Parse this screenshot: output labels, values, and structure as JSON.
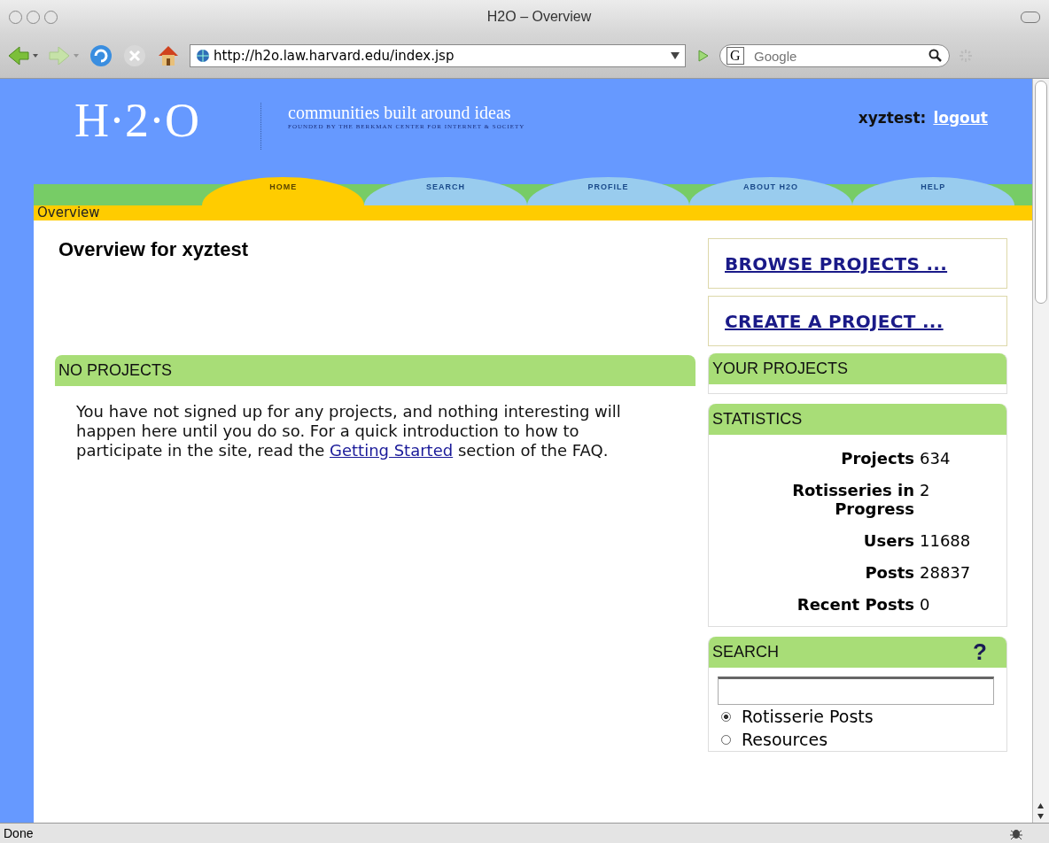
{
  "window": {
    "title": "H2O – Overview"
  },
  "toolbar": {
    "url": "http://h2o.law.harvard.edu/index.jsp",
    "search_engine": "G",
    "search_placeholder": "Google"
  },
  "site": {
    "logo": "H·2·O",
    "tagline": "communities built around ideas",
    "subtitle": "FOUNDED BY THE BERKMAN CENTER FOR INTERNET & SOCIETY",
    "user": "xyztest:",
    "logout": "logout"
  },
  "nav": [
    {
      "label": "HOME",
      "selected": true
    },
    {
      "label": "SEARCH",
      "selected": false
    },
    {
      "label": "PROFILE",
      "selected": false
    },
    {
      "label": "ABOUT H2O",
      "selected": false
    },
    {
      "label": "HELP",
      "selected": false
    }
  ],
  "breadcrumb": "Overview",
  "heading": "Overview for xyztest",
  "no_projects": {
    "title": "NO PROJECTS",
    "text_before": "You have not signed up for any projects, and nothing interesting will happen here until you do so. For a quick introduction to how to participate in the site, read the",
    "link": "Getting Started",
    "text_after": "section of the FAQ."
  },
  "actions": [
    "BROWSE PROJECTS ...",
    "CREATE A PROJECT ..."
  ],
  "your_projects": {
    "title": "YOUR PROJECTS"
  },
  "statistics": {
    "title": "STATISTICS",
    "rows": [
      {
        "label": "Projects",
        "value": "634"
      },
      {
        "label": "Rotisseries in Progress",
        "value": "2"
      },
      {
        "label": "Users",
        "value": "11688"
      },
      {
        "label": "Posts",
        "value": "28837"
      },
      {
        "label": "Recent Posts",
        "value": "0"
      }
    ]
  },
  "search": {
    "title": "SEARCH",
    "help": "?",
    "options": [
      {
        "label": "Rotisserie Posts",
        "selected": true
      },
      {
        "label": "Resources",
        "selected": false
      }
    ]
  },
  "status_bar": "Done"
}
